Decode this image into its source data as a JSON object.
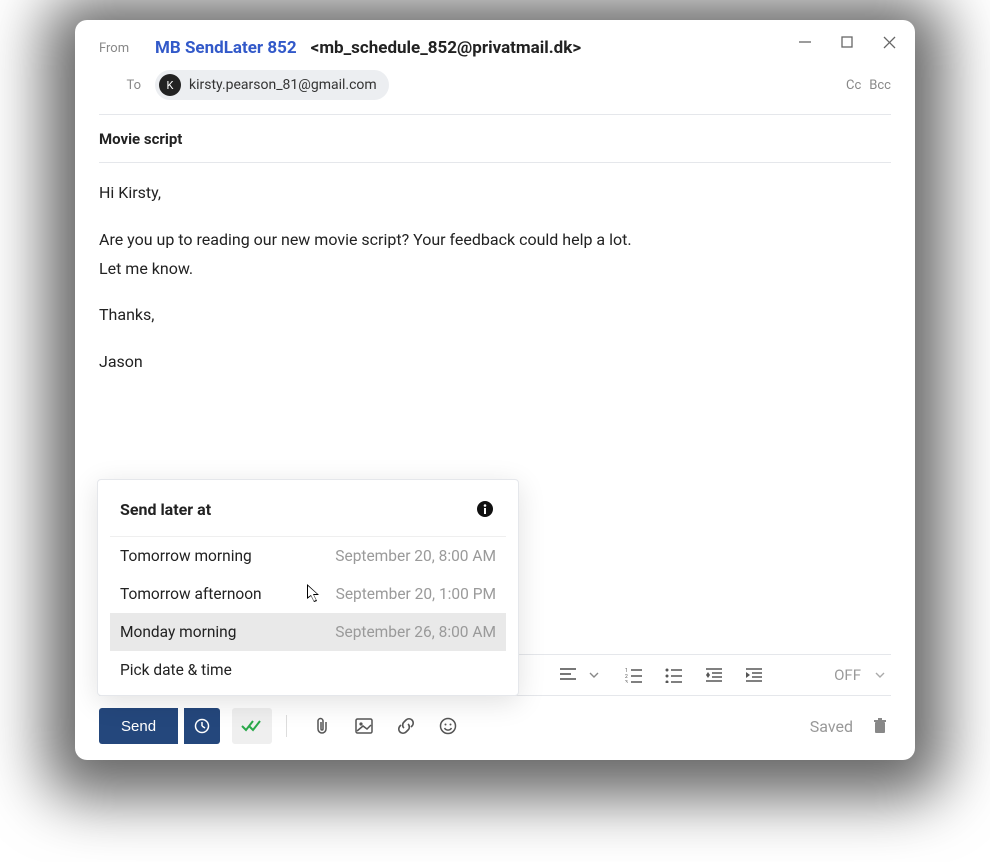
{
  "from": {
    "label": "From",
    "name": "MB SendLater 852",
    "email": "<mb_schedule_852@privatmail.dk>"
  },
  "to": {
    "label": "To",
    "avatar_initial": "K",
    "recipient": "kirsty.pearson_81@gmail.com",
    "cc": "Cc",
    "bcc": "Bcc"
  },
  "subject": "Movie script",
  "body": {
    "greeting": "Hi Kirsty,",
    "line1": "Are you up to reading our new movie script? Your feedback could help a lot.",
    "line2": "Let me know.",
    "closing": "Thanks,",
    "signature": "Jason"
  },
  "format_bar": {
    "off_label": "OFF"
  },
  "send_bar": {
    "send_label": "Send",
    "saved_label": "Saved"
  },
  "popup": {
    "title": "Send later at",
    "options": [
      {
        "label": "Tomorrow morning",
        "time": "September 20, 8:00 AM"
      },
      {
        "label": "Tomorrow afternoon",
        "time": "September 20, 1:00 PM"
      },
      {
        "label": "Monday morning",
        "time": "September 26, 8:00 AM"
      },
      {
        "label": "Pick date & time",
        "time": ""
      }
    ],
    "hover_index": 2
  }
}
